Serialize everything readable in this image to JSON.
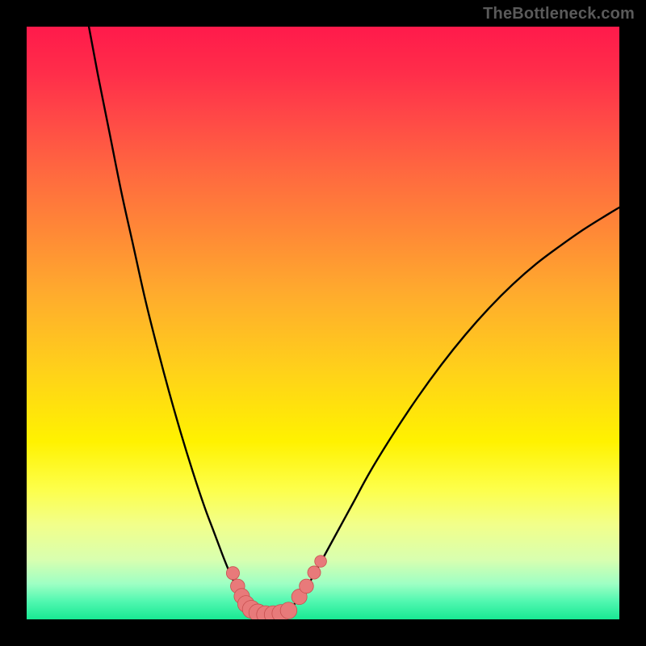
{
  "watermark": {
    "text": "TheBottleneck.com"
  },
  "colors": {
    "background": "#000000",
    "curve": "#000000",
    "marker_fill": "#e87a7a",
    "marker_stroke": "#c84f4f"
  },
  "chart_data": {
    "type": "line",
    "title": "",
    "xlabel": "",
    "ylabel": "",
    "xlim": [
      0,
      100
    ],
    "ylim": [
      0,
      100
    ],
    "grid": false,
    "legend": false,
    "series": [
      {
        "name": "left-branch",
        "x": [
          10.5,
          12,
          14,
          16,
          18,
          20,
          22,
          24,
          26,
          28,
          30,
          31.5,
          33,
          34,
          35,
          36,
          37
        ],
        "values": [
          100,
          92,
          82,
          72,
          63,
          54,
          46,
          38.5,
          31.5,
          25,
          19,
          15,
          11,
          8.5,
          6.3,
          4.5,
          3.0
        ]
      },
      {
        "name": "right-branch",
        "x": [
          45.5,
          47,
          49,
          52,
          55,
          58,
          62,
          66,
          70,
          74,
          78,
          82,
          86,
          90,
          94,
          98,
          100
        ],
        "values": [
          3.0,
          5.0,
          8.5,
          14,
          19.5,
          25,
          31.5,
          37.5,
          43,
          48,
          52.5,
          56.5,
          60,
          63,
          65.8,
          68.3,
          69.5
        ]
      },
      {
        "name": "valley-floor",
        "x": [
          37,
          38.5,
          40,
          41.5,
          43,
          44.5,
          45.5
        ],
        "values": [
          3.0,
          1.6,
          0.9,
          0.6,
          0.9,
          1.8,
          3.0
        ]
      }
    ],
    "markers": {
      "name": "valley-markers",
      "points": [
        {
          "x": 34.8,
          "y": 7.8,
          "r": 1.1
        },
        {
          "x": 35.6,
          "y": 5.6,
          "r": 1.2
        },
        {
          "x": 36.3,
          "y": 3.9,
          "r": 1.3
        },
        {
          "x": 37.0,
          "y": 2.6,
          "r": 1.4
        },
        {
          "x": 37.9,
          "y": 1.7,
          "r": 1.5
        },
        {
          "x": 39.0,
          "y": 1.1,
          "r": 1.5
        },
        {
          "x": 40.3,
          "y": 0.8,
          "r": 1.5
        },
        {
          "x": 41.6,
          "y": 0.8,
          "r": 1.5
        },
        {
          "x": 42.9,
          "y": 1.0,
          "r": 1.5
        },
        {
          "x": 44.2,
          "y": 1.5,
          "r": 1.4
        },
        {
          "x": 46.0,
          "y": 3.8,
          "r": 1.3
        },
        {
          "x": 47.2,
          "y": 5.6,
          "r": 1.2
        },
        {
          "x": 48.5,
          "y": 7.9,
          "r": 1.1
        },
        {
          "x": 49.6,
          "y": 9.8,
          "r": 1.0
        }
      ]
    }
  }
}
